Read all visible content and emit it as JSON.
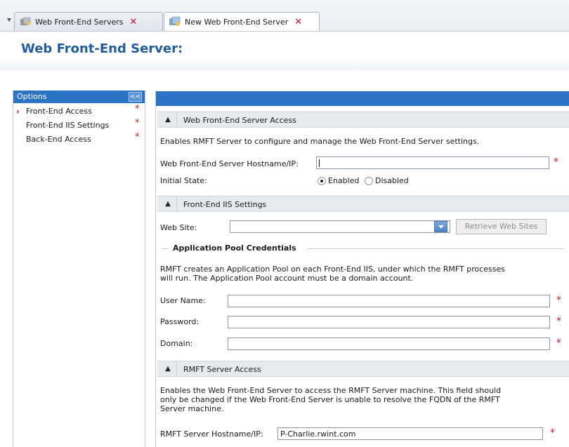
{
  "tabs": [
    {
      "label": "Web Front-End Servers",
      "icon": "server-group-icon"
    },
    {
      "label": "New Web Front-End Server",
      "icon": "server-new-icon"
    }
  ],
  "page_title": "Web Front-End Server:",
  "sidebar": {
    "header": "Options",
    "collapse_label": "<<",
    "items": [
      {
        "label": "Front-End Access",
        "required": "*"
      },
      {
        "label": "Front-End IIS Settings",
        "required": "*"
      },
      {
        "label": "Back-End Access",
        "required": "*"
      }
    ]
  },
  "main": {
    "sections": [
      {
        "title": "Web Front-End Server Access"
      },
      {
        "title": "Front-End IIS Settings"
      },
      {
        "title": "RMFT Server Access"
      }
    ],
    "wfe_desc": "Enables RMFT Server to configure and manage the Web Front-End Server settings.",
    "hostname_label": "Web Front-End Server Hostname/IP:",
    "hostname_value": "",
    "initial_state_label": "Initial State:",
    "enabled_label": "Enabled",
    "disabled_label": "Disabled",
    "website_label": "Web Site:",
    "website_value": "",
    "retrieve_label": "Retrieve Web Sites",
    "app_pool_heading": "Application Pool Credentials",
    "app_pool_desc_1": "RMFT creates an Application Pool on each Front-End IIS, under which the RMFT processes",
    "app_pool_desc_2": "will run. The Application Pool account must be a domain account.",
    "username_label": "User Name:",
    "username_value": "",
    "password_label": "Password:",
    "password_value": "",
    "domain_label": "Domain:",
    "domain_value": "",
    "rmft_desc_1": "Enables the Web Front-End Server to access the RMFT Server machine. This field should",
    "rmft_desc_2": "only be changed if the Web Front-End Server is unable to resolve the FQDN of the RMFT",
    "rmft_desc_3": "Server machine.",
    "rmft_hostname_label": "RMFT Server Hostname/IP:",
    "rmft_hostname_value": "P-Charlie.rwint.com",
    "required_mark": "*"
  },
  "colors": {
    "accent": "#2a73c5",
    "title": "#1f5c9a",
    "required": "#d21818"
  }
}
